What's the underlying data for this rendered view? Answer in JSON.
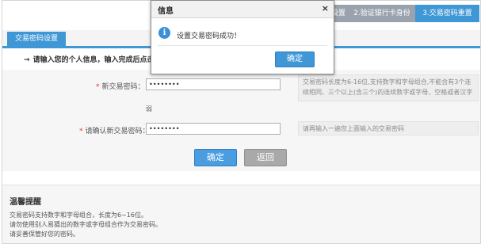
{
  "steps": [
    {
      "label": "设置",
      "state": "done"
    },
    {
      "label": "2.验证银行卡身份",
      "state": "done"
    },
    {
      "label": "3.交易密码重置",
      "state": "active"
    }
  ],
  "tab": {
    "label": "交易密码设置"
  },
  "prompt": {
    "text": "请输入您的个人信息，输入完成后点击"
  },
  "form": {
    "new_password": {
      "required_mark": "*",
      "label": "新交易密码：",
      "value": "••••••••"
    },
    "strength_label": "弱",
    "confirm_password": {
      "required_mark": "*",
      "label": "请确认新交易密码：",
      "value": "••••••••"
    },
    "hint_new": "交易密码长度为6-16位,支持数字和字母组合,不能含有3个连续相同、三个以上(含三个)的连续数字或字母、空格或者汉字",
    "hint_confirm": "请再输入一遍您上面输入的交易密码",
    "ok_label": "确定",
    "back_label": "返回"
  },
  "tips": {
    "title": "温馨提醒",
    "lines": [
      "交易密码支持数字和字母组合，长度为6~16位。",
      "请勿使用别人易猜出的数字或字母组合作为交易密码。",
      "请妥善保管好您的密码。"
    ]
  },
  "dialog": {
    "title": "信息",
    "close_glyph": "×",
    "icon_glyph": "i",
    "message": "设置交易密码成功！",
    "ok_label": "确定"
  },
  "colors": {
    "accent": "#3f97d6",
    "step_inactive": "#9aa3ad",
    "required": "#e0302c"
  }
}
